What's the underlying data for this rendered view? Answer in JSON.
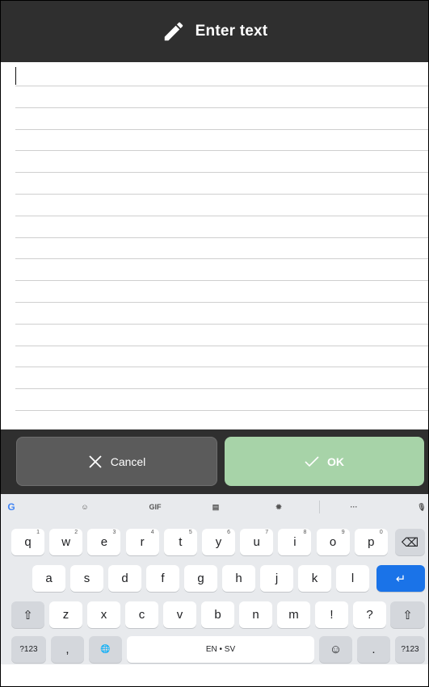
{
  "header": {
    "title": "Enter text",
    "icon": "pencil-icon"
  },
  "editor": {
    "value": "",
    "line_count": 16
  },
  "actions": {
    "cancel_label": "Cancel",
    "ok_label": "OK"
  },
  "keyboard": {
    "suggestions": [
      {
        "name": "google-icon",
        "glyph": "G"
      },
      {
        "name": "sticker-icon",
        "glyph": "☺"
      },
      {
        "name": "gif-icon",
        "glyph": "GIF"
      },
      {
        "name": "clipboard-icon",
        "glyph": "▤"
      },
      {
        "name": "settings-icon",
        "glyph": "✹"
      },
      {
        "name": "more-icon",
        "glyph": "···"
      },
      {
        "name": "microphone-icon",
        "glyph": "🎙"
      }
    ],
    "row1": [
      {
        "k": "q",
        "h": "1"
      },
      {
        "k": "w",
        "h": "2"
      },
      {
        "k": "e",
        "h": "3"
      },
      {
        "k": "r",
        "h": "4"
      },
      {
        "k": "t",
        "h": "5"
      },
      {
        "k": "y",
        "h": "6"
      },
      {
        "k": "u",
        "h": "7"
      },
      {
        "k": "i",
        "h": "8"
      },
      {
        "k": "o",
        "h": "9"
      },
      {
        "k": "p",
        "h": "0"
      }
    ],
    "row2": [
      "a",
      "s",
      "d",
      "f",
      "g",
      "h",
      "j",
      "k",
      "l"
    ],
    "row3": [
      "z",
      "x",
      "c",
      "v",
      "b",
      "n",
      "m",
      "!",
      "?"
    ],
    "backspace": "⌫",
    "enter": "↵",
    "shift": "⇧",
    "symbols": "?123",
    "comma": ",",
    "globe": "🌐",
    "space": "EN • SV",
    "emoji": "☺",
    "period": "."
  }
}
